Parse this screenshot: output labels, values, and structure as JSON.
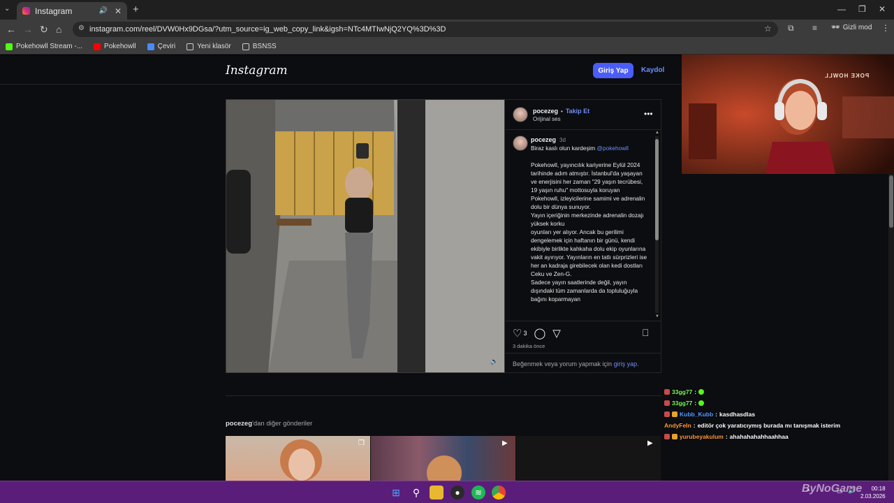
{
  "browser": {
    "tab_title": "Instagram",
    "url": "instagram.com/reel/DVW0Hx9DGsa/?utm_source=ig_web_copy_link&igsh=NTc4MTIwNjQ2YQ%3D%3D",
    "incognito_label": "Gizli mod",
    "bookmarks": [
      "Pokehowll Stream -...",
      "Pokehowll",
      "Çeviri",
      "Yeni klasör",
      "BSNSS"
    ]
  },
  "instagram": {
    "logo": "Instagram",
    "login_label": "Giriş Yap",
    "signup_label": "Kaydol",
    "post": {
      "username": "pocezeg",
      "follow_label": "Takip Et",
      "audio": "Orijinal ses",
      "caption_user": "pocezeg",
      "caption_age": "3d",
      "caption_line": "Biraz kaslı olun kardeşim",
      "caption_mention": "@pokehowll",
      "caption_body": [
        "Pokehowll, yayıncılık kariyerine Eylül 2024 tarihinde adım atmıştır. İstanbul'da yaşayan ve enerjisini her zaman \"29 yaşın tecrübesi, 19 yaşın ruhu\" mottosuyla koruyan Pokehowll, izleyicilerine samimi ve adrenalin dolu bir dünya sunuyor.",
        "Yayın içeriğinin merkezinde adrenalin dozajı yüksek korku",
        "oyunları yer alıyor. Ancak bu gerilimi dengelemek için haftanın bir günü, kendi ekibiyle birlikte kahkaha dolu ekip oyunlarına vakit ayırıyor. Yayınların en tatlı sürprizleri ise her an kadraja girebilecek olan kedi dostları Ceku ve Zen-G.",
        "Sadece yayın saatlerinde değil, yayın dışındaki tüm zamanlarda da topluluğuyla bağını koparmayan"
      ],
      "like_count": "3",
      "time_ago": "3 dakika önce",
      "login_prompt": "Beğenmek veya yorum yapmak için",
      "login_link": "giriş yap."
    },
    "more_posts_user": "pocezeg",
    "more_posts_suffix": "'dan diğer gönderiler"
  },
  "chat": [
    {
      "user": "33gg77",
      "text": "",
      "color": "#7CFC5A"
    },
    {
      "user": "33gg77",
      "text": "",
      "color": "#7CFC5A"
    },
    {
      "user": "Kubb_Kubb",
      "text": "kasdhasdlas",
      "color": "#5A9BFF"
    },
    {
      "user": "AndyFeIn",
      "text": "editör çok yaratıcıymış burada mı tanışmak isterim",
      "color": "#FF9A3C"
    },
    {
      "user": "yurubeyakulum",
      "text": "ahahahahahhaahhaa",
      "color": "#FF9A3C"
    }
  ],
  "webcam": {
    "sign_text": "POKE HOWLL"
  },
  "taskbar": {
    "time": "00:18",
    "date": "2.03.2026",
    "watermark": "ByNoGame"
  },
  "colors": {
    "accent": "#4a5df9",
    "link": "#6f8ef8",
    "taskbar": "#5a1e7a"
  }
}
